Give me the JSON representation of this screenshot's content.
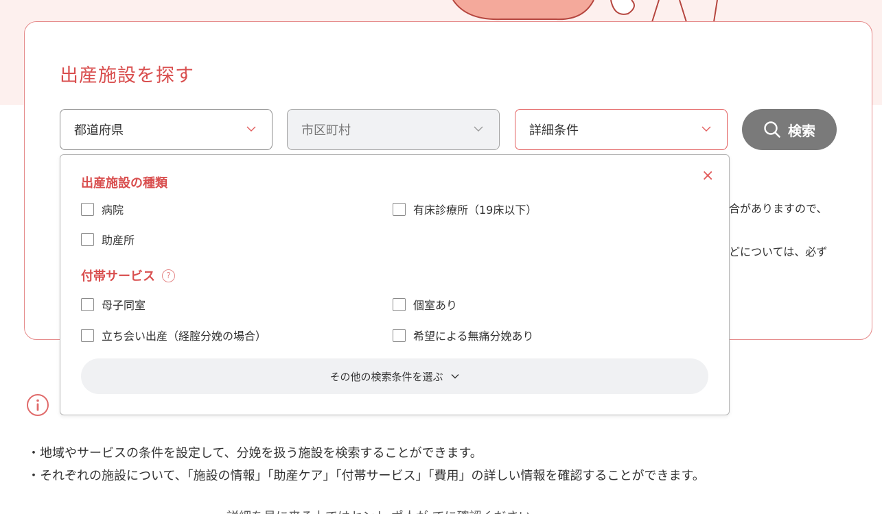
{
  "card": {
    "title": "出産施設を探す"
  },
  "selects": {
    "prefecture": "都道府県",
    "city": "市区町村",
    "detail": "詳細条件"
  },
  "search_button": {
    "label": "検索",
    "icon": "search-icon"
  },
  "background_text": {
    "line1": "合がありますので、",
    "line2": "どについては、必ず"
  },
  "dropdown": {
    "close_label": "×",
    "section_type": {
      "title": "出産施設の種類",
      "options": [
        "病院",
        "有床診療所（19床以下）",
        "助産所"
      ]
    },
    "section_service": {
      "title": "付帯サービス",
      "help_icon": "question-circle-icon",
      "help_glyph": "?",
      "options": [
        "母子同室",
        "個室あり",
        "立ち会い出産（経腟分娩の場合）",
        "希望による無痛分娩あり"
      ]
    },
    "more_label": "その他の検索条件を選ぶ"
  },
  "notes": {
    "icon": "info-icon",
    "bullets": [
      "・地域やサービスの条件を設定して、分娩を扱う施設を検索することができます。",
      "・それぞれの施設について、「施設の情報」「助産ケア」「付帯サービス」「費用」の詳しい情報を確認することができます。"
    ],
    "cut_line": "詳細を見に来る上ではセント ポ人が  てに確認ください"
  },
  "colors": {
    "accent": "#d94f4f",
    "card_border": "#e58a8a",
    "band": "#fdf0ee",
    "search_button": "#7a7a7a"
  }
}
